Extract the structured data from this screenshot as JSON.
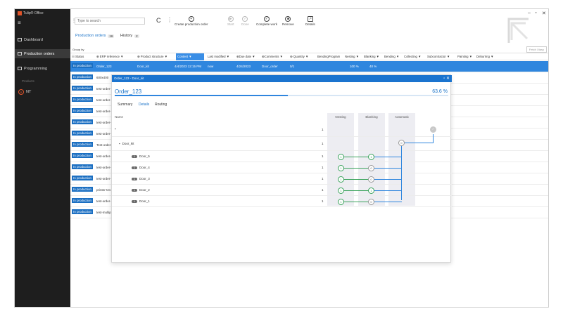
{
  "app": {
    "title": "Tulip® Office",
    "menu": "≡"
  },
  "window_controls": [
    "–",
    "▫",
    "✕"
  ],
  "sidebar": {
    "items": [
      {
        "label": "Dashboard"
      },
      {
        "label": "Production orders"
      },
      {
        "label": "Programming"
      }
    ],
    "section": "Products",
    "user": {
      "initial": "R",
      "label": "NT"
    }
  },
  "toolbar": {
    "search_placeholder": "Type to search",
    "refresh": "C",
    "more": "⋮",
    "buttons": [
      {
        "label": "Create production order",
        "icon": "+",
        "enabled": true
      },
      {
        "label": "Start",
        "icon": "▶",
        "enabled": false
      },
      {
        "label": "Done",
        "icon": "✓",
        "enabled": false
      },
      {
        "label": "Complete work",
        "icon": "✓",
        "enabled": true
      },
      {
        "label": "Remove",
        "icon": "■",
        "enabled": true
      },
      {
        "label": "Details",
        "icon": "↗",
        "enabled": true
      }
    ],
    "fetch_label": "Fetch Xtasy"
  },
  "tabs": [
    {
      "label": "Production orders",
      "count": "16"
    },
    {
      "label": "History",
      "count": "2"
    }
  ],
  "group_by": "Group by",
  "columns": [
    "Status",
    "ERP reference",
    "Product structure",
    "Content",
    "Last modified",
    "Due date",
    "Comments",
    "Quantity",
    "BendingProgram",
    "Nesting",
    "Blanking",
    "Bending",
    "Collecting",
    "Subcontractor",
    "Painting",
    "Deburring"
  ],
  "rows": [
    {
      "status": "In production",
      "name": "Order_123",
      "product": "Door_kit",
      "last_modified": "4/4/2023 12:15 PM",
      "due": "now",
      "due_date": "4/24/2023",
      "comments": "Door_order",
      "quantity": "0/1",
      "nesting": "100 %",
      "blanking": "40 %",
      "selected": true
    },
    {
      "status": "In production",
      "name": "600x400"
    },
    {
      "status": "In production",
      "name": "test-order-"
    },
    {
      "status": "In production",
      "name": "test-order-"
    },
    {
      "status": "In production",
      "name": "test-order-"
    },
    {
      "status": "In production",
      "name": "test-order-"
    },
    {
      "status": "In production",
      "name": "test-order-"
    },
    {
      "status": "In production",
      "name": "Test-order-"
    },
    {
      "status": "In production",
      "name": "test-order-"
    },
    {
      "status": "In production",
      "name": "test-order-"
    },
    {
      "status": "In production",
      "name": "test-order-"
    },
    {
      "status": "In production",
      "name": "printer-tes"
    },
    {
      "status": "In production",
      "name": "test-order-"
    },
    {
      "status": "In production",
      "name": "test-multip"
    }
  ],
  "dialog": {
    "header": "Order_123 - Door_kit",
    "title": "Order_123",
    "percent": "63.6",
    "percent_unit": "%",
    "progress": 0.52,
    "tabs": [
      "Summary",
      "Details",
      "Routing"
    ],
    "name_header": "Name",
    "columns": [
      "Nesting",
      "Blanking",
      "Automatic"
    ],
    "tree": [
      {
        "label": "",
        "qty": "1"
      },
      {
        "label": "Door_kit",
        "qty": "1",
        "auto": "0"
      },
      {
        "label": "Door_5",
        "qty": "1",
        "pill": "1",
        "nest": "1",
        "blank": "1"
      },
      {
        "label": "Door_4",
        "qty": "1",
        "pill": "1",
        "nest": "1",
        "blank": "0"
      },
      {
        "label": "Door_3",
        "qty": "1",
        "pill": "1",
        "nest": "1",
        "blank": "0"
      },
      {
        "label": "Door_2",
        "qty": "1",
        "pill": "1",
        "nest": "1",
        "blank": "1"
      },
      {
        "label": "Door_1",
        "qty": "1",
        "pill": "1",
        "nest": "1",
        "blank": "0"
      }
    ]
  }
}
